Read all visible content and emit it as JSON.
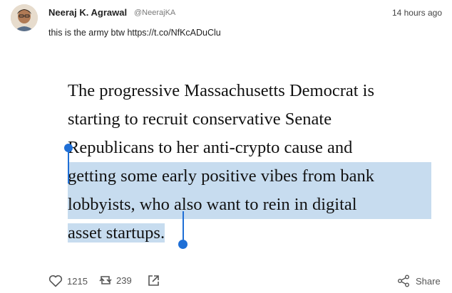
{
  "tweet": {
    "author_name": "Neeraj K. Agrawal",
    "author_handle": "@NeerajKA",
    "timestamp": "14 hours ago",
    "text": "this is the army btw https://t.co/NfKcADuClu"
  },
  "quoted_text": {
    "line1": "The progressive Massachusetts Democrat is",
    "line2": "starting to recruit conservative Senate",
    "line3": "Republicans to her anti-crypto cause and",
    "line4": "getting some early positive vibes from bank",
    "line5": "lobbyists, who also want to rein in digital",
    "line6": "asset startups."
  },
  "actions": {
    "likes": "1215",
    "retweets": "239",
    "share_label": "Share"
  },
  "colors": {
    "selection": "#c7dcef",
    "handle": "#1f6fd6"
  }
}
